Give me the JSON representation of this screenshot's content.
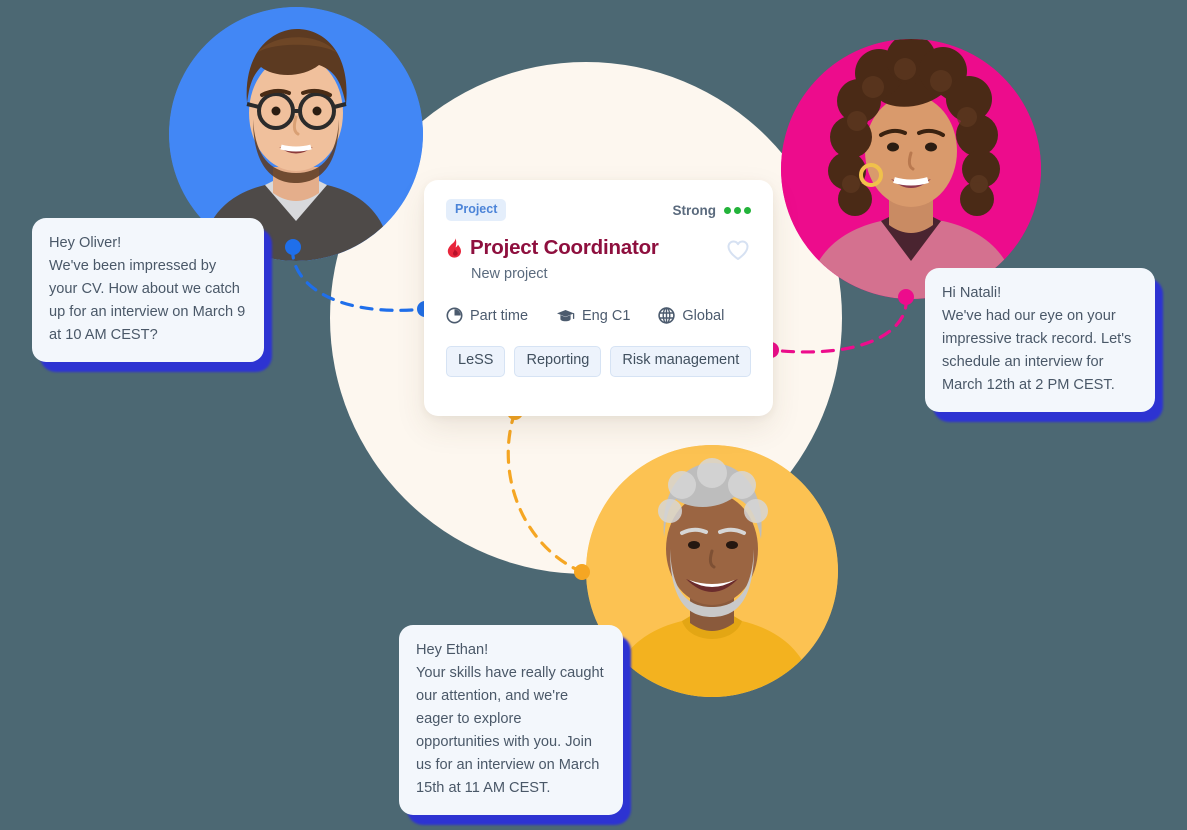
{
  "background": {
    "page_color": "#4C6873",
    "blob_color": "#FDF7EF"
  },
  "card": {
    "badge": "Project",
    "strength_label": "Strong",
    "strength_dots": 3,
    "strength_color": "#23B33A",
    "title": "Project Coordinator",
    "title_color": "#8E0F3E",
    "flame_icon": "flame-icon",
    "subtitle": "New project",
    "favorite_icon": "heart-icon",
    "meta": [
      {
        "icon": "clock-icon",
        "label": "Part time"
      },
      {
        "icon": "graduation-cap-icon",
        "label": "Eng C1"
      },
      {
        "icon": "globe-icon",
        "label": "Global"
      }
    ],
    "chips": [
      "LeSS",
      "Reporting",
      "Risk management"
    ]
  },
  "avatars": [
    {
      "name": "Oliver",
      "color": "#4287F5"
    },
    {
      "name": "Natali",
      "color": "#ED0C8C"
    },
    {
      "name": "Ethan",
      "color": "#FCC252"
    }
  ],
  "messages": {
    "oliver": "Hey Oliver!\nWe've been impressed by your CV. How about we catch up for an interview on March 9 at 10 AM CEST?",
    "natali": "Hi Natali!\nWe've had our eye on your impressive track record. Let's schedule an interview for March 12th at 2 PM CEST.",
    "ethan": "Hey Ethan!\nYour skills have really caught our attention, and we're eager to explore opportunities with you. Join us for an interview on March 15th at 11 AM CEST."
  },
  "connectors": [
    {
      "name": "oliver-to-card",
      "color": "#1F6FEB"
    },
    {
      "name": "natali-to-card",
      "color": "#ED0C8C"
    },
    {
      "name": "ethan-to-card",
      "color": "#F5A623"
    }
  ]
}
